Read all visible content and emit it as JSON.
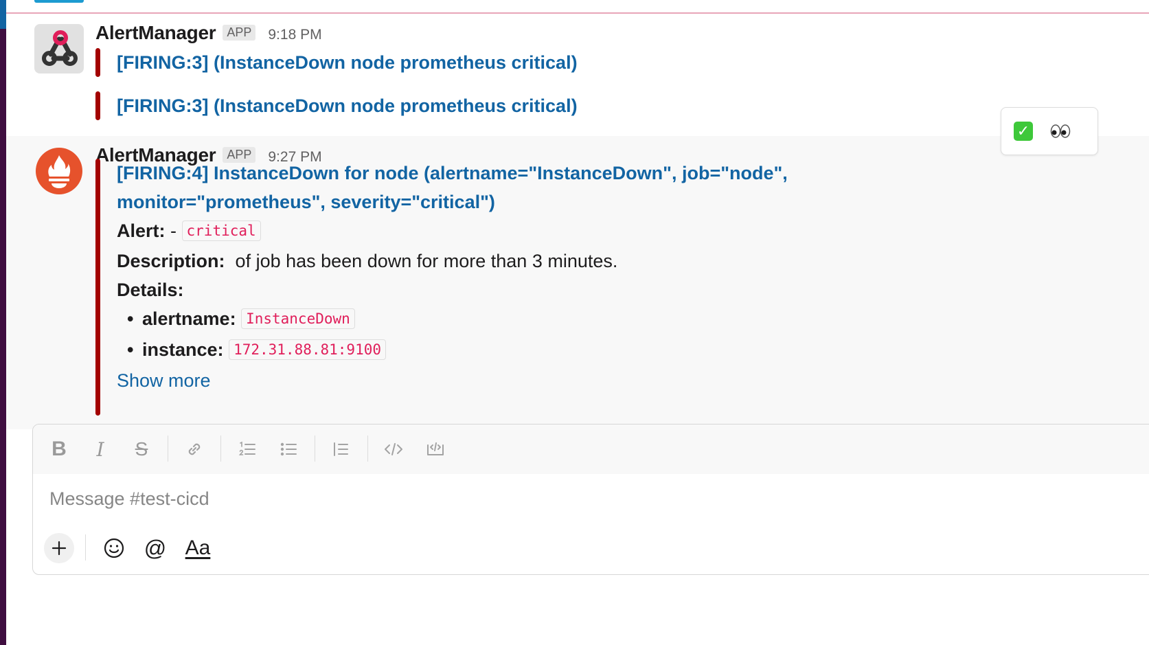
{
  "channel": {
    "name": "#test-cicd"
  },
  "colors": {
    "alert_bar": "#a30200",
    "link": "#1264a3",
    "code_text": "#e01e5a",
    "sidebar": "#3f0e40"
  },
  "messages": [
    {
      "sender": "AlertManager",
      "badge": "APP",
      "time": "9:18 PM",
      "avatar_icon": "webhook-icon",
      "attachments": [
        {
          "title": "[FIRING:3]  (InstanceDown node prometheus critical)"
        },
        {
          "title": "[FIRING:3]  (InstanceDown node prometheus critical)"
        }
      ]
    },
    {
      "sender": "AlertManager",
      "badge": "APP",
      "time": "9:27 PM",
      "avatar_icon": "prometheus-icon",
      "title_line1": "[FIRING:4] InstanceDown for node (alertname=\"InstanceDown\", job=\"node\",",
      "title_line2": "monitor=\"prometheus\", severity=\"critical\")",
      "alert_label": "Alert:",
      "alert_sep": " - ",
      "alert_value": "critical",
      "description_label": "Description:",
      "description_value": "of job  has been down for more than 3 minutes.",
      "details_label": "Details:",
      "details": [
        {
          "key": "alertname:",
          "value": "InstanceDown"
        },
        {
          "key": "instance:",
          "value": "172.31.88.81:9100"
        }
      ],
      "show_more": "Show more"
    }
  ],
  "reactions": [
    {
      "icon": "white-check-mark-icon",
      "glyph": "✓"
    },
    {
      "icon": "eyes-icon"
    }
  ],
  "composer": {
    "placeholder": "Message #test-cicd",
    "toolbar": [
      "bold-icon",
      "italic-icon",
      "strikethrough-icon",
      "link-icon",
      "ordered-list-icon",
      "bulleted-list-icon",
      "blockquote-icon",
      "code-icon",
      "code-block-icon"
    ],
    "bold_glyph": "B",
    "italic_glyph": "I",
    "strike_glyph": "S",
    "at_glyph": "@",
    "format_label": "Aa"
  }
}
